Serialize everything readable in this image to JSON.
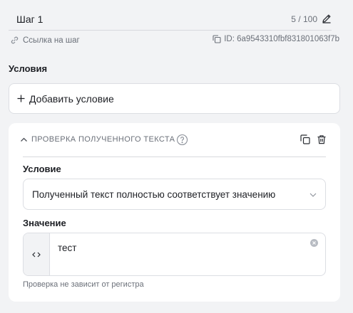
{
  "step": {
    "name": "Шаг 1",
    "counter": "5 / 100",
    "link_label": "Ссылка на шаг",
    "id_label": "ID: 6a9543310fbf831801063f7b"
  },
  "conditions": {
    "title": "Условия",
    "add_label": "Добавить условие"
  },
  "card": {
    "title": "ПРОВЕРКА ПОЛУЧЕННОГО ТЕКСТА",
    "condition_label": "Условие",
    "condition_value": "Полученный текст полностью соответствует значению",
    "value_label": "Значение",
    "value_text": "тест",
    "hint": "Проверка не зависит от регистра"
  },
  "icons": [
    "pencil-icon",
    "link-icon",
    "copy-icon",
    "plus-icon",
    "chevron-up-icon",
    "help-icon",
    "duplicate-icon",
    "trash-icon",
    "chevron-down-icon",
    "code-icon",
    "clear-icon"
  ],
  "colors": {
    "background": "#f2f3f5",
    "card": "#ffffff",
    "border": "#dcdee3",
    "muted_text": "#6b7079",
    "text": "#1d1f24"
  }
}
